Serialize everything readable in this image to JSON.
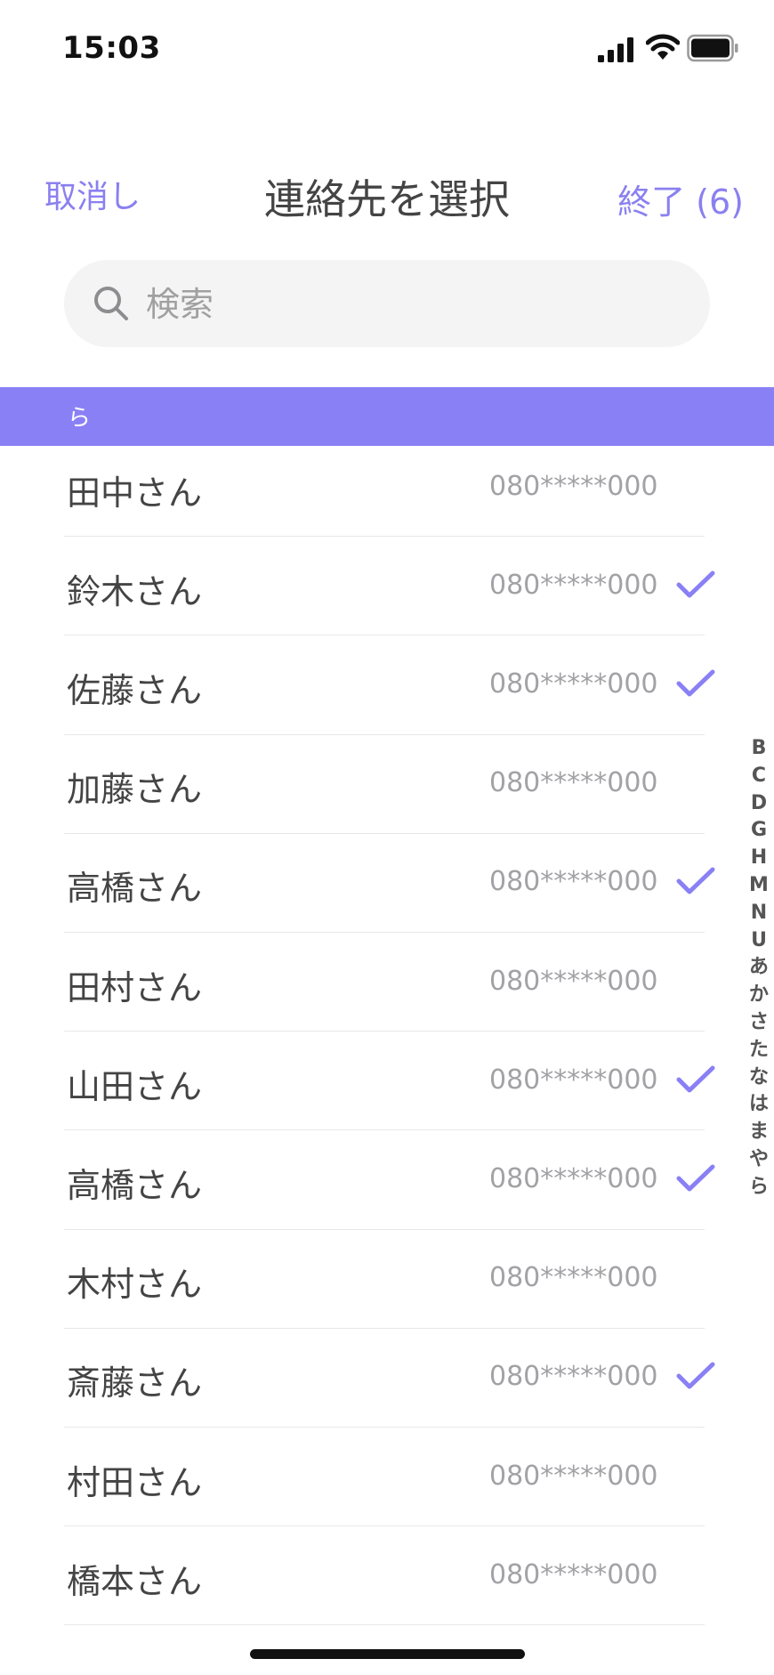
{
  "status_bar": {
    "time": "15:03"
  },
  "nav": {
    "cancel_label": "取消し",
    "title": "連絡先を選択",
    "done_label": "終了 (6)"
  },
  "search": {
    "placeholder": "検索"
  },
  "section_header": "ら",
  "contacts": [
    {
      "name": "田中さん",
      "phone": "080*****000",
      "selected": false
    },
    {
      "name": "鈴木さん",
      "phone": "080*****000",
      "selected": true
    },
    {
      "name": "佐藤さん",
      "phone": "080*****000",
      "selected": true
    },
    {
      "name": "加藤さん",
      "phone": "080*****000",
      "selected": false
    },
    {
      "name": "高橋さん",
      "phone": "080*****000",
      "selected": true
    },
    {
      "name": "田村さん",
      "phone": "080*****000",
      "selected": false
    },
    {
      "name": "山田さん",
      "phone": "080*****000",
      "selected": true
    },
    {
      "name": "高橋さん",
      "phone": "080*****000",
      "selected": true
    },
    {
      "name": "木村さん",
      "phone": "080*****000",
      "selected": false
    },
    {
      "name": "斎藤さん",
      "phone": "080*****000",
      "selected": true
    },
    {
      "name": "村田さん",
      "phone": "080*****000",
      "selected": false
    },
    {
      "name": "橋本さん",
      "phone": "080*****000",
      "selected": false
    }
  ],
  "index_letters": [
    "B",
    "C",
    "D",
    "G",
    "H",
    "M",
    "N",
    "U",
    "あ",
    "か",
    "さ",
    "た",
    "な",
    "は",
    "ま",
    "や",
    "ら"
  ],
  "colors": {
    "accent": "#8a80f5"
  }
}
